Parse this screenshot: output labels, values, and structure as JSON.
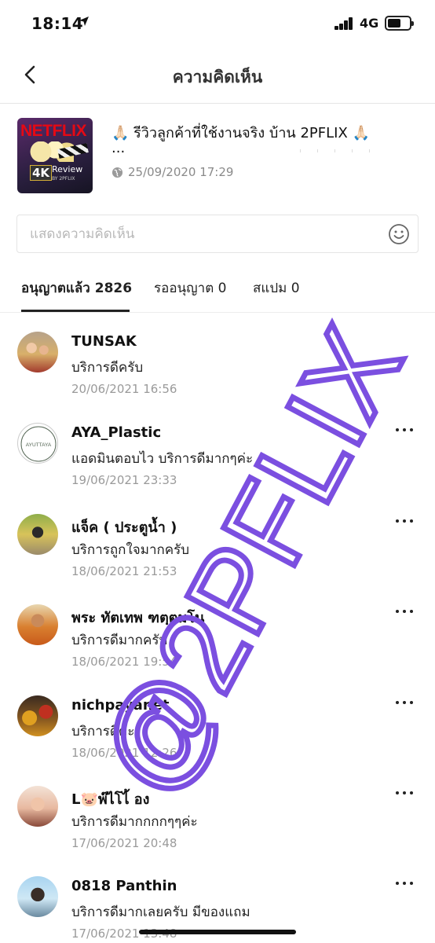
{
  "status_bar": {
    "time": "18:14",
    "network": "4G"
  },
  "header": {
    "title": "ความคิดเห็น",
    "back_icon": "chevron-left-icon"
  },
  "post": {
    "title": "🙏🏻 รีวิวลูกค้าที่ใช้งานจริง บ้าน 2PFLIX 🙏🏻",
    "ellipsis": "...",
    "timestamp": "25/09/2020 17:29",
    "thumbnail_text": {
      "brand": "NETFLIX",
      "badge": "4K",
      "label": "Review",
      "sublabel": "BY 2PFLIX"
    }
  },
  "comment_input": {
    "placeholder": "แสดงความคิดเห็น",
    "value": "",
    "emoji_icon": "smiley-icon"
  },
  "tabs": [
    {
      "label": "อนุญาตแล้ว 2826",
      "active": true
    },
    {
      "label": "รออนุญาต 0",
      "active": false
    },
    {
      "label": "สแปม 0",
      "active": false
    }
  ],
  "comments": [
    {
      "name": "TUNSAK",
      "text": "บริการดีครับ",
      "time": "20/06/2021 16:56",
      "has_menu": false
    },
    {
      "name": "AYA_Plastic",
      "text": "แอดมินตอบไว บริการดีมากๆค่ะ",
      "time": "19/06/2021 23:33",
      "has_menu": true,
      "avatar_text": "AYUTTAYA"
    },
    {
      "name": "แจ็ค ( ประตูน้ำ )",
      "text": "บริการถูกใจมากครับ",
      "time": "18/06/2021 21:53",
      "has_menu": true
    },
    {
      "name": "พระ ทัตเทพ ฑตฺตมโน",
      "text": "บริการดีมากครับ",
      "time": "18/06/2021 19:54",
      "has_menu": true
    },
    {
      "name": "nichpayanet",
      "text": "บริการดีค่ะ",
      "time": "18/06/2021 12:26",
      "has_menu": true
    },
    {
      "name": "L🐷พ๊ไโไ้ อง",
      "text": "บริการดีมากกกกๆๆค่ะ",
      "time": "17/06/2021 20:48",
      "has_menu": true
    },
    {
      "name": "0818 Panthin",
      "text": "บริการดีมากเลยครับ มีของแถม",
      "time": "17/06/2021 13:48",
      "has_menu": true
    }
  ],
  "watermark": {
    "text": "@2PFLIX",
    "color": "#7b4fe0"
  }
}
